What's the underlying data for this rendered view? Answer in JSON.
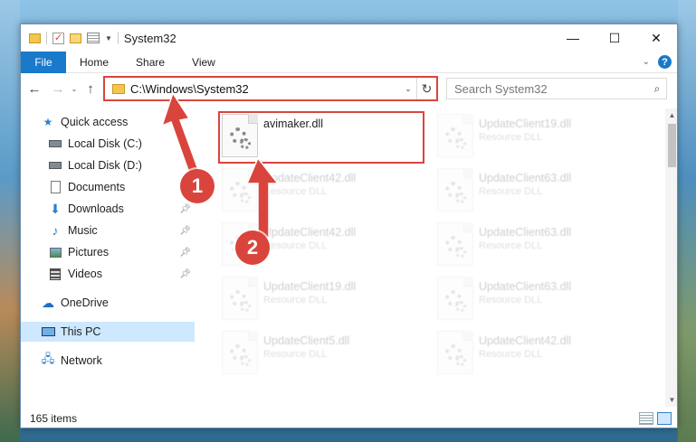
{
  "window": {
    "title": "System32",
    "controls": {
      "minimize": "—",
      "maximize": "☐",
      "close": "✕"
    }
  },
  "ribbon": {
    "file_tab": "File",
    "tabs": [
      "Home",
      "Share",
      "View"
    ],
    "help": "?"
  },
  "address": {
    "path": "C:\\Windows\\System32",
    "search_placeholder": "Search System32"
  },
  "nav_pane": {
    "items": [
      {
        "label": "Quick access",
        "icon": "star-icon",
        "pinned": false
      },
      {
        "label": "Local Disk (C:)",
        "icon": "drive-icon",
        "pinned": false
      },
      {
        "label": "Local Disk (D:)",
        "icon": "drive-icon",
        "pinned": false
      },
      {
        "label": "Documents",
        "icon": "documents-icon",
        "pinned": false
      },
      {
        "label": "Downloads",
        "icon": "downloads-icon",
        "pinned": true
      },
      {
        "label": "Music",
        "icon": "music-icon",
        "pinned": true
      },
      {
        "label": "Pictures",
        "icon": "pictures-icon",
        "pinned": true
      },
      {
        "label": "Videos",
        "icon": "videos-icon",
        "pinned": true
      },
      {
        "label": "OneDrive",
        "icon": "cloud-icon",
        "pinned": false
      },
      {
        "label": "This PC",
        "icon": "computer-icon",
        "pinned": false,
        "selected": true
      },
      {
        "label": "Network",
        "icon": "network-icon",
        "pinned": false
      }
    ]
  },
  "files": [
    {
      "name": "avimaker.dll",
      "type": "",
      "highlighted": true
    },
    {
      "name": "UpdateClient19.dll",
      "type": "Resource DLL"
    },
    {
      "name": "UpdateClient42.dll",
      "type": "Resource DLL"
    },
    {
      "name": "UpdateClient63.dll",
      "type": "Resource DLL"
    },
    {
      "name": "UpdateClient42.dll",
      "type": "Resource DLL"
    },
    {
      "name": "UpdateClient63.dll",
      "type": "Resource DLL"
    },
    {
      "name": "UpdateClient19.dll",
      "type": "Resource DLL"
    },
    {
      "name": "UpdateClient63.dll",
      "type": "Resource DLL"
    },
    {
      "name": "UpdateClient5.dll",
      "type": "Resource DLL"
    },
    {
      "name": "UpdateClient42.dll",
      "type": "Resource DLL"
    }
  ],
  "status": {
    "item_count": "165 items"
  },
  "annotations": {
    "badge1": "1",
    "badge2": "2"
  },
  "colors": {
    "accent": "#1979ca",
    "highlight": "#d9453d",
    "selection": "#cde8ff"
  }
}
